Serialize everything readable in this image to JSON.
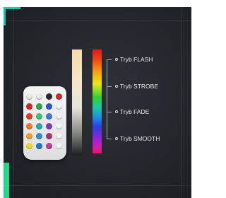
{
  "modes": [
    {
      "label": "Tryb FLASH"
    },
    {
      "label": "Tryb STROBE"
    },
    {
      "label": "Tryb FADE"
    },
    {
      "label": "Tryb SMOOTH"
    }
  ],
  "colors": {
    "background": "#22262b",
    "accent": "#15c7a8",
    "label_text": "#e6e8ea"
  },
  "remote": {
    "button_colors": [
      [
        "#e9e9e9",
        "#e9e9e9",
        "#2a2a2a",
        "#d92323"
      ],
      [
        "#d92323",
        "#2ca84a",
        "#2b54c8",
        "#f2f2f2"
      ],
      [
        "#e03a2a",
        "#42c26a",
        "#3f7ad8",
        "#f2f2f2"
      ],
      [
        "#ef7a22",
        "#2aa9a0",
        "#7a3fb8",
        "#f2f2f2"
      ],
      [
        "#f2a024",
        "#2893c6",
        "#a2387a",
        "#f2f2f2"
      ],
      [
        "#f2d624",
        "#2277c4",
        "#c63a9a",
        "#f2f2f2"
      ]
    ]
  }
}
